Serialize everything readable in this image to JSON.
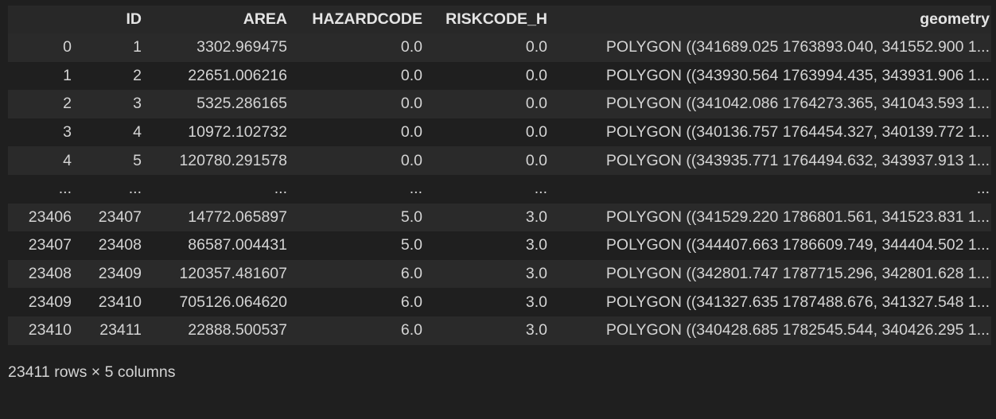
{
  "table": {
    "columns": [
      "",
      "ID",
      "AREA",
      "HAZARDCODE",
      "RISKCODE_H",
      "geometry"
    ],
    "rows": [
      [
        "0",
        "1",
        "3302.969475",
        "0.0",
        "0.0",
        "POLYGON ((341689.025 1763893.040, 341552.900 1..."
      ],
      [
        "1",
        "2",
        "22651.006216",
        "0.0",
        "0.0",
        "POLYGON ((343930.564 1763994.435, 343931.906 1..."
      ],
      [
        "2",
        "3",
        "5325.286165",
        "0.0",
        "0.0",
        "POLYGON ((341042.086 1764273.365, 341043.593 1..."
      ],
      [
        "3",
        "4",
        "10972.102732",
        "0.0",
        "0.0",
        "POLYGON ((340136.757 1764454.327, 340139.772 1..."
      ],
      [
        "4",
        "5",
        "120780.291578",
        "0.0",
        "0.0",
        "POLYGON ((343935.771 1764494.632, 343937.913 1..."
      ],
      [
        "...",
        "...",
        "...",
        "...",
        "...",
        "..."
      ],
      [
        "23406",
        "23407",
        "14772.065897",
        "5.0",
        "3.0",
        "POLYGON ((341529.220 1786801.561, 341523.831 1..."
      ],
      [
        "23407",
        "23408",
        "86587.004431",
        "5.0",
        "3.0",
        "POLYGON ((344407.663 1786609.749, 344404.502 1..."
      ],
      [
        "23408",
        "23409",
        "120357.481607",
        "6.0",
        "3.0",
        "POLYGON ((342801.747 1787715.296, 342801.628 1..."
      ],
      [
        "23409",
        "23410",
        "705126.064620",
        "6.0",
        "3.0",
        "POLYGON ((341327.635 1787488.676, 341327.548 1..."
      ],
      [
        "23410",
        "23411",
        "22888.500537",
        "6.0",
        "3.0",
        "POLYGON ((340428.685 1782545.544, 340426.295 1..."
      ]
    ]
  },
  "summary": "23411 rows × 5 columns"
}
